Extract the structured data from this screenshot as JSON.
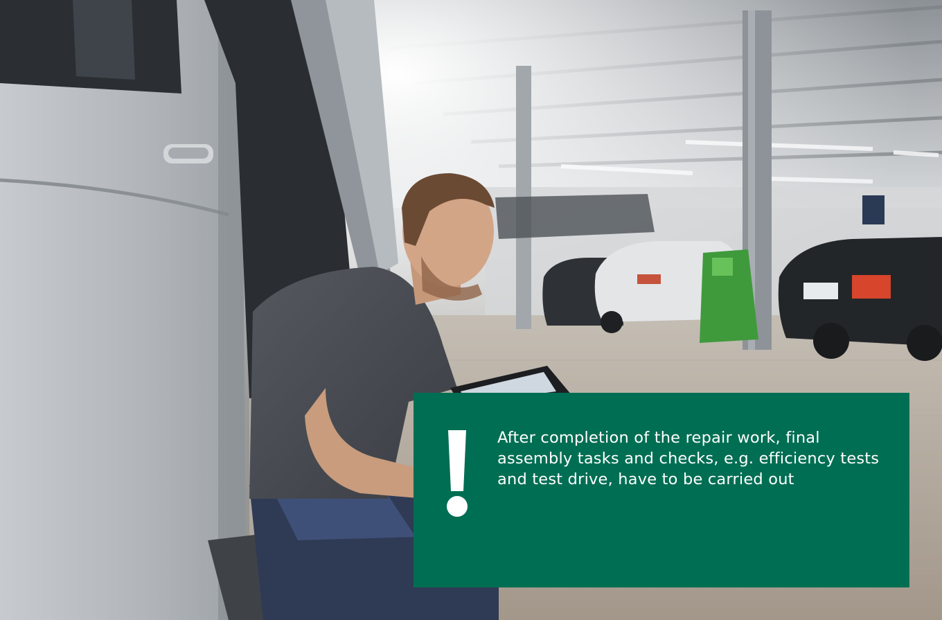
{
  "notice": {
    "icon": "exclamation-icon",
    "text": "After completion of the repair work, final assembly tasks and checks, e.g. efficiency tests and test drive, have to be carried out",
    "background_color": "#006e53",
    "text_color": "#ffffff"
  }
}
